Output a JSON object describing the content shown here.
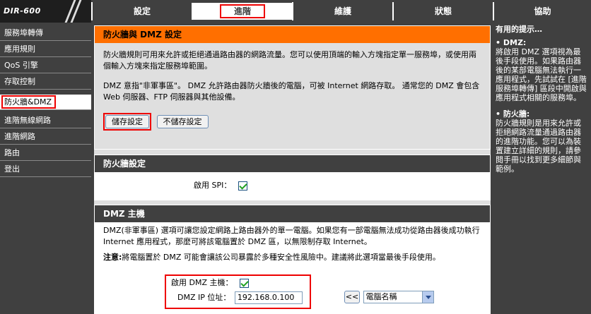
{
  "logo": {
    "text": "DIR-600"
  },
  "tabs": [
    {
      "label": "設定"
    },
    {
      "label": "進階"
    },
    {
      "label": "維護"
    },
    {
      "label": "狀態"
    },
    {
      "label": "協助"
    }
  ],
  "sidebar": {
    "items": [
      {
        "label": "服務埠轉傳"
      },
      {
        "label": "應用規則"
      },
      {
        "label": "QoS 引擎"
      },
      {
        "label": "存取控制"
      },
      {
        "label": "防火牆&DMZ"
      },
      {
        "label": "進階無線網路"
      },
      {
        "label": "進階網路"
      },
      {
        "label": "路由"
      },
      {
        "label": "登出"
      }
    ]
  },
  "main": {
    "fw_dmz": {
      "title": "防火牆與 DMZ 設定",
      "desc1": "防火牆規則可用來允許或拒絕通過路由器的網路流量。您可以使用頂端的輸入方塊指定單一服務埠，或使用兩個輸入方塊來指定服務埠範圍。",
      "desc2": "DMZ 意指\"非軍事區\"。 DMZ 允許路由器防火牆後的電腦，可被 Internet 網路存取。 通常您的 DMZ 會包含 Web 伺服器、FTP 伺服器與其他設備。",
      "save_label": "儲存設定",
      "nosave_label": "不儲存設定"
    },
    "firewall": {
      "title": "防火牆設定",
      "spi_label": "啟用 SPI："
    },
    "dmz": {
      "title": "DMZ 主機",
      "desc": "DMZ(非軍事區) 選項可讓您設定網路上路由器外的單一電腦。如果您有一部電腦無法成功從路由器後成功執行 Internet 應用程式，那麼可將該電腦置於 DMZ 區，以無限制存取 Internet。",
      "note_bold": "注意:",
      "note": "將電腦置於 DMZ 可能會讓該公司暴露於多種安全性風險中。建議將此選項當最後手段使用。",
      "enable_label": "啟用 DMZ 主機：",
      "ip_label": "DMZ IP 位址：",
      "ip_value": "192.168.0.100",
      "arrow_label": "<<",
      "computer_select": "電腦名稱"
    }
  },
  "help": {
    "title": "有用的提示…",
    "dmz_title": "• DMZ:",
    "dmz_text": "將啟用 DMZ 選項視為最後手段使用。如果路由器後的某部電腦無法執行一應用程式，先試試在 [進階服務埠轉傳] 區段中開啟與應用程式相關的服務埠。",
    "fw_title": "• 防火牆:",
    "fw_text": "防火牆規則是用來允許或拒絕網路流量通過路由器的進階功能。您可以為裝置建立詳細的規則，請參閱手冊以找到更多細節與範例。"
  },
  "colors": {
    "dark": "#404040",
    "orange": "#ff6f00",
    "highlight": "#e00000"
  }
}
